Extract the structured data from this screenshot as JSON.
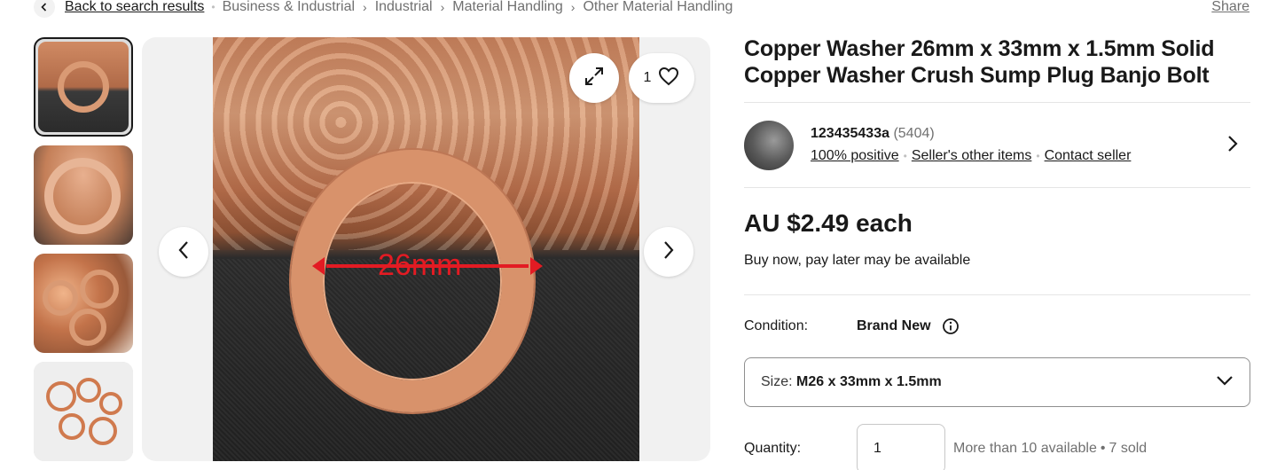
{
  "breadcrumb": {
    "back_label": "Back to search results",
    "items": [
      "Business & Industrial",
      "Industrial",
      "Material Handling",
      "Other Material Handling"
    ]
  },
  "share_label": "Share",
  "gallery": {
    "watch_count": "1",
    "image_annotation": "26mm",
    "thumbnail_count": 4
  },
  "product": {
    "title": "Copper Washer 26mm x 33mm x 1.5mm Solid Copper Washer Crush Sump Plug Banjo Bolt"
  },
  "seller": {
    "name": "123435433a",
    "feedback_count": "(5404)",
    "positive": "100% positive",
    "other_items": "Seller's other items",
    "contact": "Contact seller"
  },
  "price": {
    "amount": "AU $2.49 each",
    "bnpl": "Buy now, pay later may be available"
  },
  "condition": {
    "label": "Condition:",
    "value": "Brand New"
  },
  "size": {
    "label": "Size:",
    "value": "M26 x 33mm x 1.5mm"
  },
  "quantity": {
    "label": "Quantity:",
    "value": "1",
    "available": "More than 10 available",
    "sold": "7 sold"
  },
  "icons": {
    "back": "chevron-left-icon",
    "expand": "expand-icon",
    "watch": "heart-icon",
    "prev": "chevron-left-icon",
    "next": "chevron-right-icon",
    "seller_chevron": "chevron-right-icon",
    "info": "info-icon",
    "dropdown": "chevron-down-icon"
  }
}
